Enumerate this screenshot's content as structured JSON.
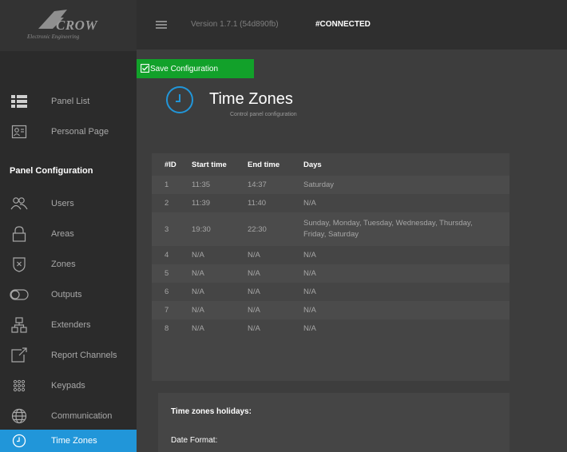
{
  "logo": {
    "brand": "CROW",
    "tagline": "Electronic Engineering"
  },
  "topbar": {
    "version": "Version 1.7.1 (54d890fb)",
    "status": "#CONNECTED"
  },
  "toolbar": {
    "save_label": "Save Configuration"
  },
  "sidebar": {
    "top_items": [
      {
        "label": "Panel List",
        "icon": "list-icon"
      },
      {
        "label": "Personal Page",
        "icon": "id-card-icon"
      }
    ],
    "section_title": "Panel Configuration",
    "items": [
      {
        "label": "Users",
        "icon": "users-icon"
      },
      {
        "label": "Areas",
        "icon": "lock-icon"
      },
      {
        "label": "Zones",
        "icon": "shield-icon"
      },
      {
        "label": "Outputs",
        "icon": "toggle-icon"
      },
      {
        "label": "Extenders",
        "icon": "network-icon"
      },
      {
        "label": "Report Channels",
        "icon": "report-icon"
      },
      {
        "label": "Keypads",
        "icon": "keypad-icon"
      },
      {
        "label": "Communication",
        "icon": "globe-icon"
      },
      {
        "label": "Time Zones",
        "icon": "clock-icon",
        "active": true
      }
    ]
  },
  "header": {
    "title": "Time Zones",
    "subtitle": "Control panel configuration"
  },
  "table": {
    "columns": [
      "#ID",
      "Start time",
      "End time",
      "Days"
    ],
    "rows": [
      [
        "1",
        "11:35",
        "14:37",
        "Saturday"
      ],
      [
        "2",
        "11:39",
        "11:40",
        "N/A"
      ],
      [
        "3",
        "19:30",
        "22:30",
        "Sunday, Monday, Tuesday, Wednesday, Thursday, Friday, Saturday"
      ],
      [
        "4",
        "N/A",
        "N/A",
        "N/A"
      ],
      [
        "5",
        "N/A",
        "N/A",
        "N/A"
      ],
      [
        "6",
        "N/A",
        "N/A",
        "N/A"
      ],
      [
        "7",
        "N/A",
        "N/A",
        "N/A"
      ],
      [
        "8",
        "N/A",
        "N/A",
        "N/A"
      ]
    ]
  },
  "holidays": {
    "title": "Time zones holidays:",
    "date_format_label": "Date Format:"
  },
  "colors": {
    "accent": "#2196d9",
    "save_green": "#12a12a",
    "sidebar_bg": "#2b2b2b",
    "content_bg": "#3d3d3d"
  }
}
